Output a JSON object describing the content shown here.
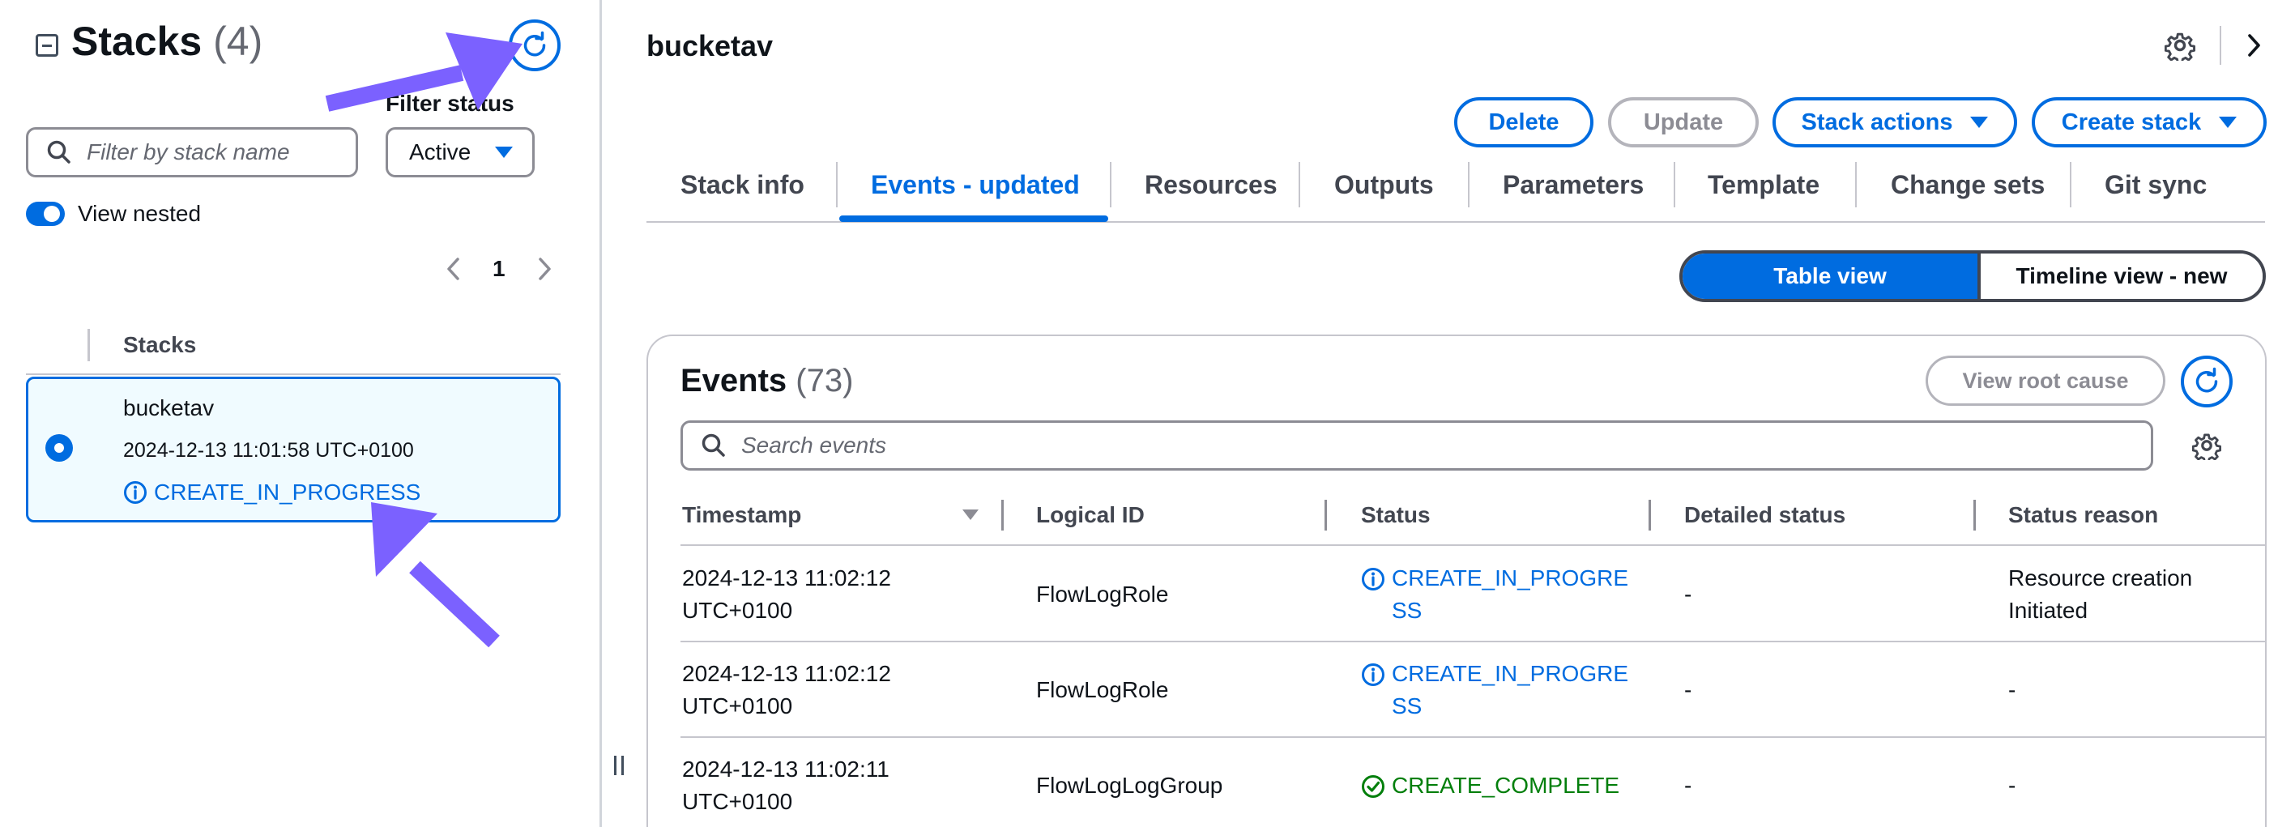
{
  "left": {
    "title": "Stacks",
    "count": "(4)",
    "filter_status_label": "Filter status",
    "filter_placeholder": "Filter by stack name",
    "status_value": "Active",
    "view_nested_label": "View nested",
    "page": "1",
    "stacks_column": "Stacks",
    "selected_stack": {
      "name": "bucketav",
      "time": "2024-12-13 11:01:58 UTC+0100",
      "status": "CREATE_IN_PROGRESS"
    }
  },
  "header": {
    "stack_name": "bucketav",
    "buttons": {
      "delete": "Delete",
      "update": "Update",
      "stack_actions": "Stack actions",
      "create_stack": "Create stack"
    }
  },
  "tabs": [
    {
      "label": "Stack info"
    },
    {
      "label": "Events - updated"
    },
    {
      "label": "Resources"
    },
    {
      "label": "Outputs"
    },
    {
      "label": "Parameters"
    },
    {
      "label": "Template"
    },
    {
      "label": "Change sets"
    },
    {
      "label": "Git sync"
    }
  ],
  "view_toggle": {
    "table": "Table view",
    "timeline": "Timeline view - new"
  },
  "events": {
    "title": "Events",
    "count": "(73)",
    "view_root_cause": "View root cause",
    "search_placeholder": "Search events",
    "columns": [
      "Timestamp",
      "Logical ID",
      "Status",
      "Detailed status",
      "Status reason"
    ],
    "rows": [
      {
        "ts1": "2024-12-13 11:02:12",
        "ts2": "UTC+0100",
        "logical_id": "FlowLogRole",
        "status": "CREATE_IN_PROGRESS",
        "detailed": "-",
        "reason": "Resource creation Initiated"
      },
      {
        "ts1": "2024-12-13 11:02:12",
        "ts2": "UTC+0100",
        "logical_id": "FlowLogRole",
        "status": "CREATE_IN_PROGRESS",
        "detailed": "-",
        "reason": "-"
      },
      {
        "ts1": "2024-12-13 11:02:11",
        "ts2": "UTC+0100",
        "logical_id": "FlowLogLogGroup",
        "status": "CREATE_COMPLETE",
        "detailed": "-",
        "reason": "-"
      }
    ]
  },
  "colors": {
    "accent": "#006ce0",
    "success": "#037f0c",
    "annotation_arrow": "#7b61ff",
    "selected_bg": "#f0fbff"
  },
  "icons": [
    "collapse-icon",
    "refresh-icon",
    "search-icon",
    "caret-down-icon",
    "chevron-left-icon",
    "chevron-right-icon",
    "info-icon",
    "check-circle-icon",
    "gear-icon",
    "sort-caret-icon",
    "annotation-arrow"
  ]
}
